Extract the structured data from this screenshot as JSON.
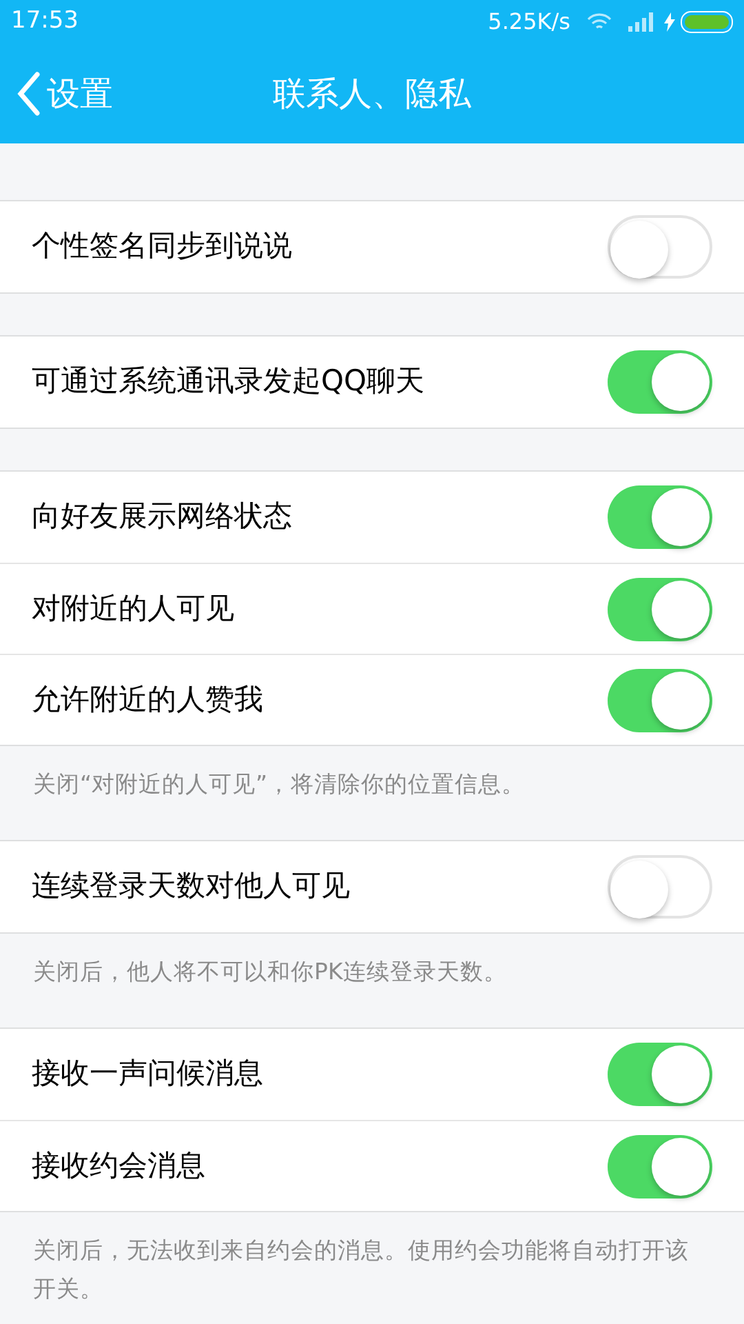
{
  "status_bar": {
    "time": "17:53",
    "speed": "5.25K/s"
  },
  "header": {
    "back": "设置",
    "title": "联系人、隐私"
  },
  "groups": [
    {
      "rows": [
        {
          "label": "个性签名同步到说说",
          "on": false
        }
      ]
    },
    {
      "rows": [
        {
          "label": "可通过系统通讯录发起QQ聊天",
          "on": true
        }
      ]
    },
    {
      "rows": [
        {
          "label": "向好友展示网络状态",
          "on": true
        },
        {
          "label": "对附近的人可见",
          "on": true
        },
        {
          "label": "允许附近的人赞我",
          "on": true
        }
      ],
      "note": "关闭“对附近的人可见”，将清除你的位置信息。"
    },
    {
      "rows": [
        {
          "label": "连续登录天数对他人可见",
          "on": false
        }
      ],
      "note": "关闭后，他人将不可以和你PK连续登录天数。"
    },
    {
      "rows": [
        {
          "label": "接收一声问候消息",
          "on": true
        },
        {
          "label": "接收约会消息",
          "on": true
        }
      ],
      "note": "关闭后，无法收到来自约会的消息。使用约会功能将自动打开该开关。"
    }
  ]
}
